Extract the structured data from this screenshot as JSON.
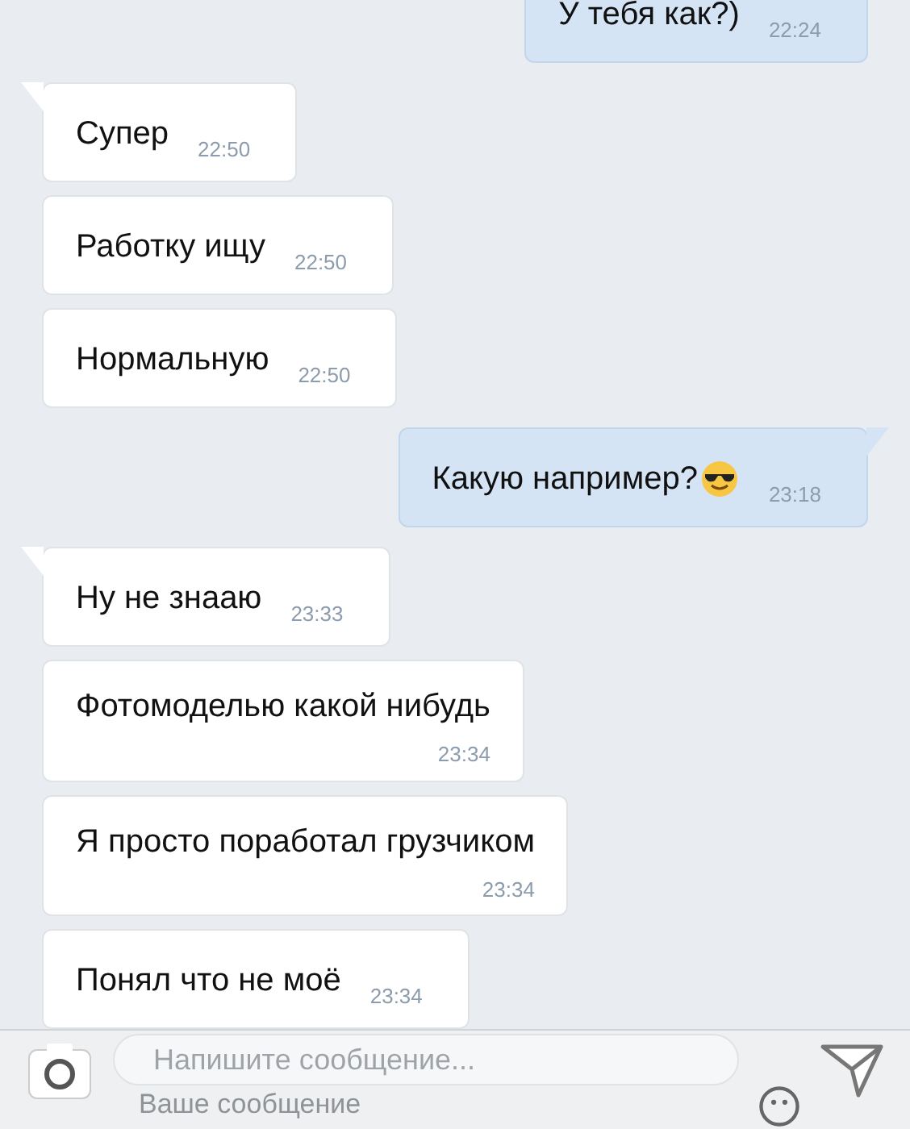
{
  "messages": [
    {
      "outgoing": true,
      "kind": "inline",
      "text": "У тебя как?)",
      "time": "22:24",
      "tail": false,
      "emoji": false
    },
    {
      "outgoing": false,
      "kind": "inline",
      "text": "Супер",
      "time": "22:50",
      "tail": true,
      "emoji": false
    },
    {
      "outgoing": false,
      "kind": "inline",
      "text": "Работку ищу",
      "time": "22:50",
      "tail": false,
      "emoji": false
    },
    {
      "outgoing": false,
      "kind": "inline",
      "text": "Нормальную",
      "time": "22:50",
      "tail": false,
      "emoji": false
    },
    {
      "outgoing": true,
      "kind": "inline",
      "text": "Какую например?",
      "time": "23:18",
      "tail": true,
      "emoji": true
    },
    {
      "outgoing": false,
      "kind": "inline",
      "text": "Ну не знааю",
      "time": "23:33",
      "tail": true,
      "emoji": false
    },
    {
      "outgoing": false,
      "kind": "stacked",
      "text": "Фотомоделью какой нибудь",
      "time": "23:34",
      "tail": false,
      "emoji": false
    },
    {
      "outgoing": false,
      "kind": "stacked",
      "text": "Я просто поработал грузчиком",
      "time": "23:34",
      "tail": false,
      "emoji": false
    },
    {
      "outgoing": false,
      "kind": "inline",
      "text": "Понял что не моё",
      "time": "23:34",
      "tail": false,
      "emoji": false
    }
  ],
  "composer": {
    "placeholder": "Напишите сообщение...",
    "second_placeholder": "Ваше сообщение"
  }
}
